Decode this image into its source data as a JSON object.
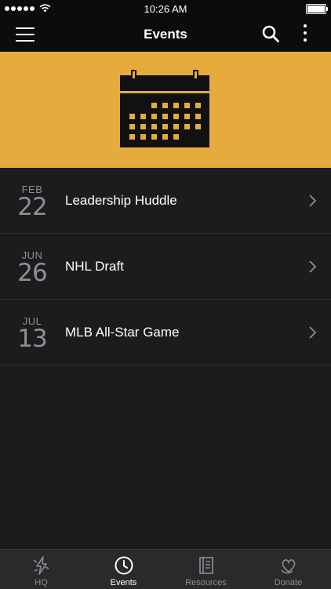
{
  "status_bar": {
    "time": "10:26 AM"
  },
  "nav": {
    "title": "Events"
  },
  "events": [
    {
      "month": "FEB",
      "day": "22",
      "title": "Leadership Huddle"
    },
    {
      "month": "JUN",
      "day": "26",
      "title": "NHL Draft"
    },
    {
      "month": "JUL",
      "day": "13",
      "title": "MLB All-Star Game"
    }
  ],
  "tabs": [
    {
      "label": "HQ",
      "icon": "bolt-icon",
      "active": false
    },
    {
      "label": "Events",
      "icon": "clock-icon",
      "active": true
    },
    {
      "label": "Resources",
      "icon": "book-icon",
      "active": false
    },
    {
      "label": "Donate",
      "icon": "heart-hand-icon",
      "active": false
    }
  ],
  "colors": {
    "accent": "#e5ab3c",
    "background": "#1c1c1e",
    "bar": "#0c0c0c"
  }
}
